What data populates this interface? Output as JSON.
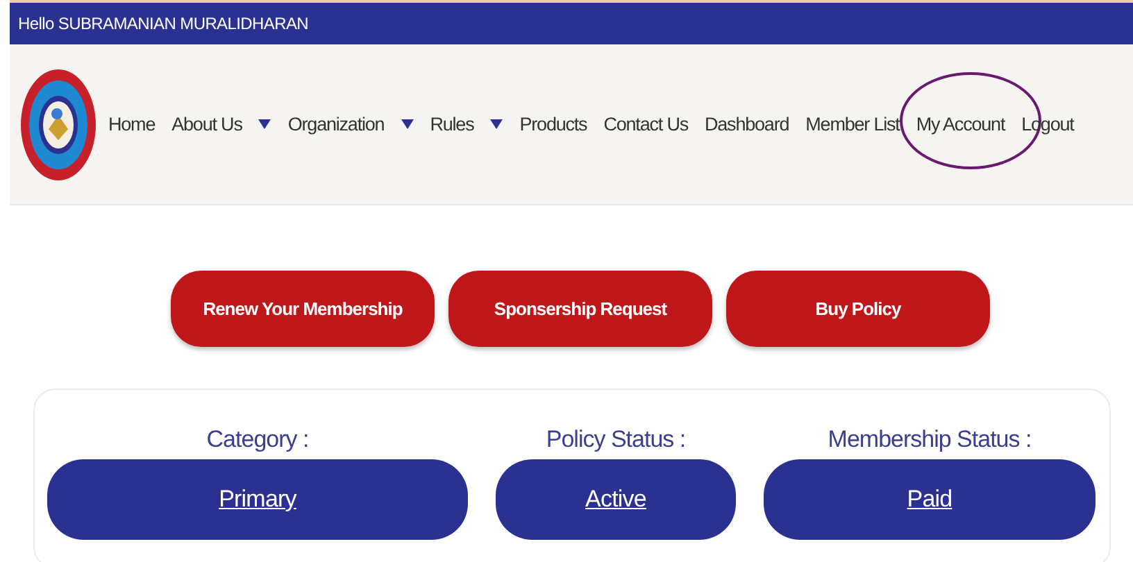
{
  "greeting": "Hello SUBRAMANIAN MURALIDHARAN",
  "nav": [
    {
      "label": "Home",
      "dropdown": false,
      "highlighted": false
    },
    {
      "label": "About Us",
      "dropdown": true,
      "highlighted": false
    },
    {
      "label": "Organization",
      "dropdown": true,
      "highlighted": false
    },
    {
      "label": "Rules",
      "dropdown": true,
      "highlighted": false
    },
    {
      "label": "Products",
      "dropdown": false,
      "highlighted": false
    },
    {
      "label": "Contact Us",
      "dropdown": false,
      "highlighted": false
    },
    {
      "label": "Dashboard",
      "dropdown": false,
      "highlighted": false
    },
    {
      "label": "Member List",
      "dropdown": false,
      "highlighted": false
    },
    {
      "label": "My Account",
      "dropdown": false,
      "highlighted": true
    },
    {
      "label": "Logout",
      "dropdown": false,
      "highlighted": false
    }
  ],
  "actions": [
    "Renew Your Membership",
    "Sponsership Request",
    "Buy Policy"
  ],
  "status": [
    {
      "label": "Category :",
      "value": "Primary"
    },
    {
      "label": "Policy Status :",
      "value": "Active"
    },
    {
      "label": "Membership Status :",
      "value": "Paid"
    }
  ]
}
